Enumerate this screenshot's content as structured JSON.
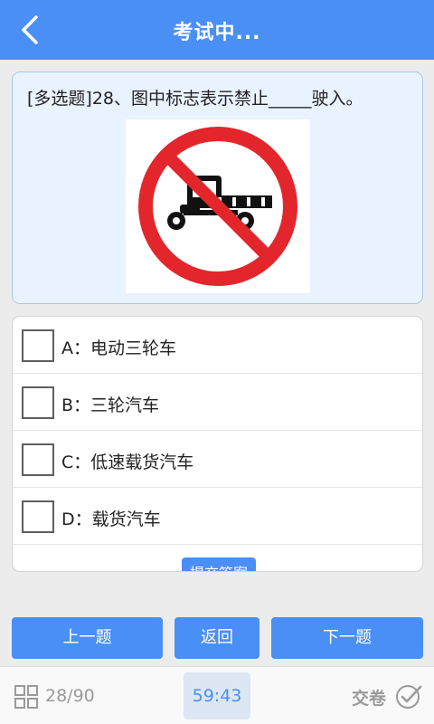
{
  "header": {
    "title": "考试中...",
    "back_icon": "chevron-left-icon"
  },
  "question": {
    "text": "[多选题]28、图中标志表示禁止_____驶入。",
    "sign_icon": "no-tricycle-sign-icon"
  },
  "options": [
    {
      "label": "A：电动三轮车",
      "checked": false
    },
    {
      "label": "B：三轮汽车",
      "checked": false
    },
    {
      "label": "C：低速载货汽车",
      "checked": false
    },
    {
      "label": "D：载货汽车",
      "checked": false
    }
  ],
  "submit_answer_label": "提交答案",
  "nav": {
    "prev": "上一题",
    "back": "返回",
    "next": "下一题"
  },
  "footer": {
    "progress": "28/90",
    "timer": "59:43",
    "submit_exam": "交卷",
    "grid_icon": "grid-icon",
    "check_icon": "check-circle-icon"
  },
  "colors": {
    "accent": "#4a8ff5",
    "sign_red": "#e3262b"
  }
}
